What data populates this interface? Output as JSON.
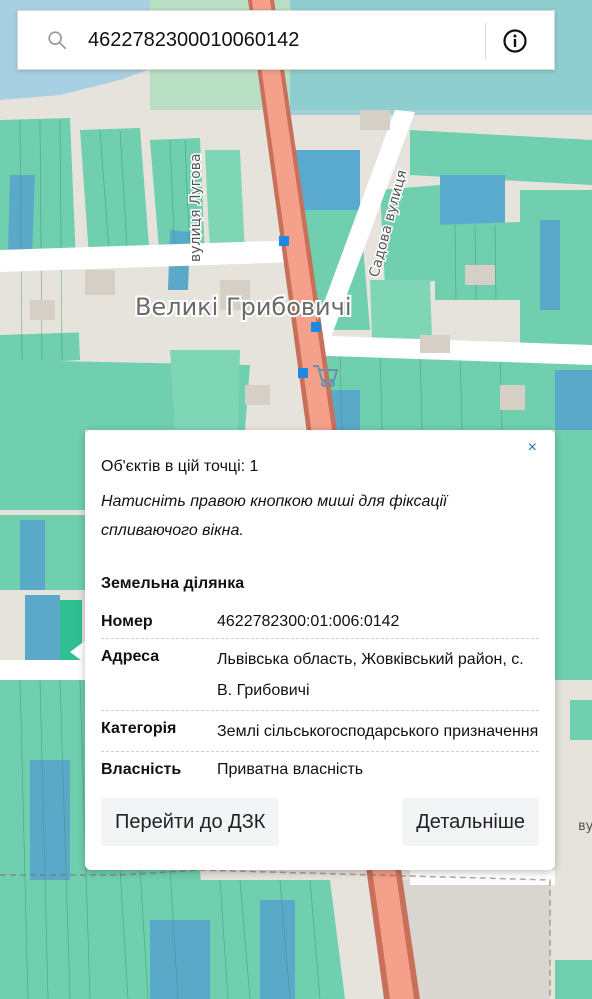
{
  "search": {
    "value": "4622782300010060142",
    "placeholder": ""
  },
  "map": {
    "place_name": "Великі Грибовичі",
    "street_1": "вулиця Лугова",
    "street_2": "Садова вулиця",
    "partial_right": "ву",
    "colors": {
      "parcel": "#5fc9a8",
      "parcel_blue": "#5aa9c9",
      "road": "#f4a08a",
      "water": "#9ec6e0",
      "marker": "#1e88e5"
    }
  },
  "popup": {
    "close_label": "×",
    "objects_count": "Об'єктів в цій точці: 1",
    "hint": "Натисніть правою кнопкою миші для фіксації спливаючого вікна.",
    "section_title": "Земельна ділянка",
    "properties": [
      {
        "key": "Номер",
        "value": "4622782300:01:006:0142"
      },
      {
        "key": "Адреса",
        "value": "Львівська область, Жовківський район, с. В. Грибовичі"
      },
      {
        "key": "Категорія",
        "value": "Землі сільськогосподарського призначення"
      },
      {
        "key": "Власність",
        "value": "Приватна власність"
      }
    ],
    "btn_dzk": "Перейти до ДЗК",
    "btn_details": "Детальніше"
  }
}
